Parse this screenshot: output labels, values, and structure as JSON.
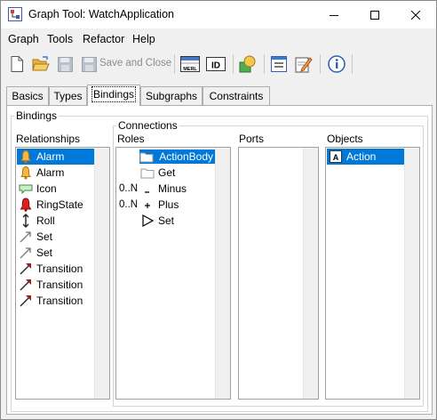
{
  "window": {
    "title": "Graph Tool: WatchApplication"
  },
  "menu": {
    "graph": "Graph",
    "tools": "Tools",
    "refactor": "Refactor",
    "help": "Help"
  },
  "toolbar": {
    "save_and_close": "Save and Close",
    "merl_icon_text": "MERL",
    "id_icon_text": "ID"
  },
  "tabs": [
    "Basics",
    "Types",
    "Bindings",
    "Subgraphs",
    "Constraints"
  ],
  "bindings": {
    "group_title": "Bindings",
    "relationships_label": "Relationships",
    "relationships": [
      {
        "label": "Alarm",
        "icon": "bell-icon"
      },
      {
        "label": "Alarm",
        "icon": "bell-icon"
      },
      {
        "label": "Icon",
        "icon": "speech-bubble-icon"
      },
      {
        "label": "RingState",
        "icon": "red-bell-icon"
      },
      {
        "label": "Roll",
        "icon": "double-arrow-icon"
      },
      {
        "label": "Set",
        "icon": "arrow-diagonal-icon"
      },
      {
        "label": "Set",
        "icon": "arrow-diagonal-icon"
      },
      {
        "label": "Transition",
        "icon": "dark-red-arrow-icon"
      },
      {
        "label": "Transition",
        "icon": "dark-red-arrow-icon"
      },
      {
        "label": "Transition",
        "icon": "dark-red-arrow-icon"
      }
    ],
    "connections_title": "Connections",
    "roles_label": "Roles",
    "roles": [
      {
        "card": "",
        "label": "ActionBody",
        "icon": "folder-icon"
      },
      {
        "card": "",
        "label": "Get",
        "icon": "folder-icon"
      },
      {
        "card": "0..N",
        "label": "Minus",
        "icon": "minus-icon"
      },
      {
        "card": "0..N",
        "label": "Plus",
        "icon": "plus-icon"
      },
      {
        "card": "",
        "label": "Set",
        "icon": "play-triangle-icon"
      }
    ],
    "ports_label": "Ports",
    "objects_label": "Objects",
    "objects": [
      {
        "label": "Action",
        "icon": "object-a-icon"
      }
    ],
    "object_icon_letter": "A"
  },
  "colors": {
    "selection": "#0078d7",
    "tab_border": "#adadad"
  }
}
